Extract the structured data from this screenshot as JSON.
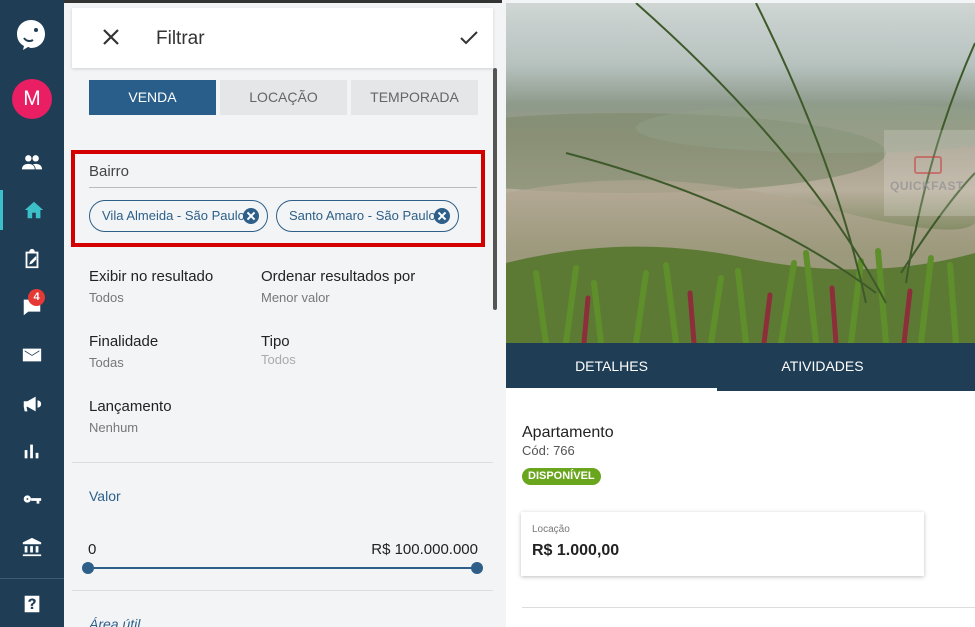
{
  "rail": {
    "avatar_letter": "M",
    "chat_badge": "4",
    "items": [
      {
        "icon": "people-icon"
      },
      {
        "icon": "home-icon",
        "active": true
      },
      {
        "icon": "clipboard-edit-icon"
      },
      {
        "icon": "chat-icon"
      },
      {
        "icon": "mail-icon"
      },
      {
        "icon": "megaphone-icon"
      },
      {
        "icon": "bar-chart-icon"
      },
      {
        "icon": "key-icon"
      },
      {
        "icon": "bank-icon"
      },
      {
        "icon": "help-icon"
      }
    ],
    "colors": {
      "background": "#1f3d55",
      "active": "#3cc0c8",
      "avatar": "#e91e63",
      "badge": "#e53935"
    }
  },
  "filter": {
    "title": "Filtrar",
    "tabs": [
      {
        "label": "VENDA",
        "selected": true
      },
      {
        "label": "LOCAÇÃO",
        "selected": false
      },
      {
        "label": "TEMPORADA",
        "selected": false
      }
    ],
    "bairro": {
      "label": "Bairro",
      "chips": [
        "Vila Almeida - São Paulo",
        "Santo Amaro - São Paulo"
      ]
    },
    "fields": {
      "exibir": {
        "label": "Exibir no resultado",
        "value": "Todos"
      },
      "ordenar": {
        "label": "Ordenar resultados por",
        "value": "Menor valor"
      },
      "finalidade": {
        "label": "Finalidade",
        "value": "Todas"
      },
      "tipo": {
        "label": "Tipo",
        "value": "Todos"
      },
      "lancamento": {
        "label": "Lançamento",
        "value": "Nenhum"
      }
    },
    "valor": {
      "label": "Valor",
      "min": "0",
      "max": "R$ 100.000.000"
    },
    "area": {
      "label": "Área útil"
    },
    "colors": {
      "accent": "#285e89",
      "highlight_box": "#d40000"
    }
  },
  "property": {
    "watermark": "QUICKFAST",
    "tabs": [
      {
        "label": "DETALHES",
        "selected": true
      },
      {
        "label": "ATIVIDADES",
        "selected": false
      }
    ],
    "type": "Apartamento",
    "code": "Cód: 766",
    "status": "DISPONÍVEL",
    "price_label": "Locação",
    "price_value": "R$ 1.000,00",
    "colors": {
      "status": "#6aa51e",
      "tabs_bg": "#1f3d55"
    }
  }
}
